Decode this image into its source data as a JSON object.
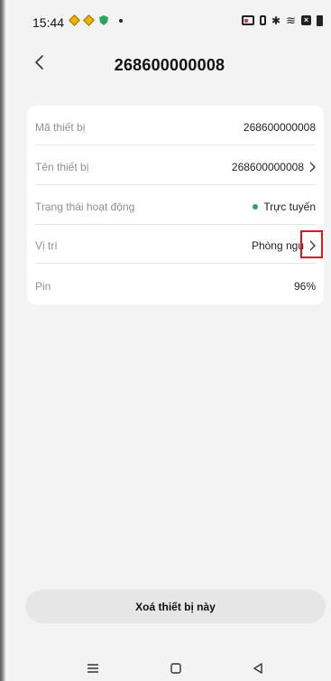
{
  "status_bar": {
    "time": "15:44",
    "left_icons": [
      "notification-diamond-icon",
      "notification-diamond-icon",
      "shield-icon",
      "more-dot-icon"
    ],
    "right_icons": [
      "cast-icon",
      "vibrate-icon",
      "bluetooth-icon",
      "wifi-icon",
      "data-off-icon",
      "battery-icon"
    ]
  },
  "header": {
    "title": "268600000008",
    "back_icon": "chevron-left-icon"
  },
  "device_info": {
    "rows": [
      {
        "label": "Mã thiết bị",
        "value": "268600000008",
        "has_chevron": false
      },
      {
        "label": "Tên thiết bị",
        "value": "268600000008",
        "has_chevron": true
      },
      {
        "label": "Trạng thái hoạt động",
        "value": "Trực tuyến",
        "has_chevron": false,
        "status_color": "#2ca45a"
      },
      {
        "label": "Vị trí",
        "value": "Phòng ngủ",
        "has_chevron": true
      },
      {
        "label": "Pin",
        "value": "96%",
        "has_chevron": false
      }
    ]
  },
  "actions": {
    "delete_label": "Xoá thiết bị này"
  },
  "nav_bar": {
    "icons": [
      "menu-icon",
      "home-icon",
      "back-triangle-icon"
    ]
  },
  "colors": {
    "background": "#f3f3f3",
    "card": "#ffffff",
    "online": "#2ca45a",
    "highlight_box": "#e0141f",
    "delete_button": "#e6e6e6"
  }
}
